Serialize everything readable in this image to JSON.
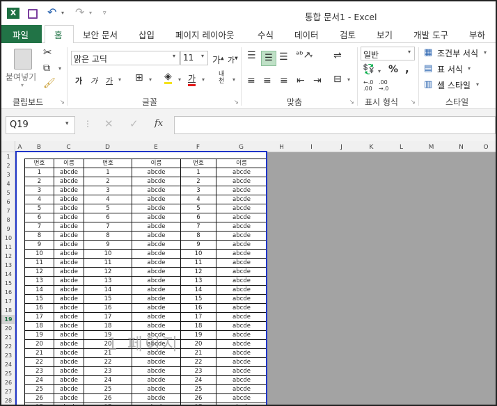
{
  "title": "통합 문서1 - Excel",
  "tabs": [
    "파일",
    "홈",
    "보안 문서",
    "삽입",
    "페이지 레이아웃",
    "수식",
    "데이터",
    "검토",
    "보기",
    "개발 도구",
    "부하 테"
  ],
  "groups": {
    "clipboard": "클립보드",
    "font": "글꼴",
    "align": "맞춤",
    "number": "표시 형식",
    "style": "스타일"
  },
  "paste_label": "붙여넣기",
  "font_name": "맑은 고딕",
  "font_size": "11",
  "number_format": "일반",
  "style_items": [
    "조건부 서식",
    "표 서식",
    "셀 스타일"
  ],
  "name_box": "Q19",
  "fx": "fx",
  "columns": [
    "A",
    "B",
    "C",
    "D",
    "E",
    "F",
    "G",
    "H",
    "I",
    "J",
    "K",
    "L",
    "M",
    "N",
    "O"
  ],
  "header": [
    "번호",
    "이름",
    "번호",
    "이름",
    "번호",
    "이름"
  ],
  "cell_text": "abcde",
  "rows": [
    "1",
    "2",
    "3",
    "4",
    "5",
    "6",
    "7",
    "8",
    "9",
    "10",
    "11",
    "12",
    "13",
    "14",
    "15",
    "16",
    "17",
    "18",
    "19",
    "20",
    "21",
    "22",
    "23",
    "24",
    "25",
    "26",
    "27",
    "28"
  ],
  "watermark": "1 페이지",
  "colors": {
    "file_tab": "#217346",
    "page_border": "#1f35c8",
    "gray_area": "#a3a3a3"
  }
}
